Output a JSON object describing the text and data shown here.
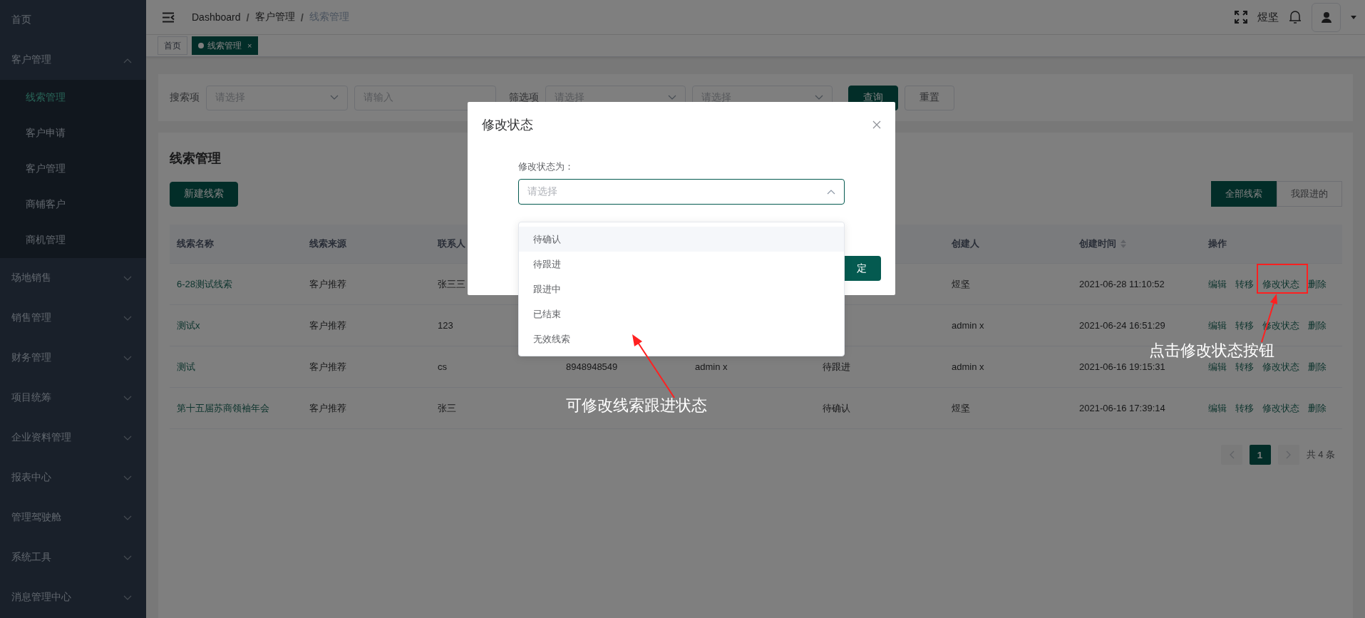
{
  "sidebar": {
    "items": [
      {
        "kind": "link",
        "label": "首页"
      },
      {
        "kind": "group",
        "label": "客户管理",
        "expanded": true,
        "children": [
          {
            "label": "线索管理",
            "selected": true
          },
          {
            "label": "客户申请",
            "selected": false
          },
          {
            "label": "客户管理",
            "selected": false
          },
          {
            "label": "商铺客户",
            "selected": false
          },
          {
            "label": "商机管理",
            "selected": false
          }
        ]
      },
      {
        "kind": "group",
        "label": "场地销售",
        "expanded": false
      },
      {
        "kind": "group",
        "label": "销售管理",
        "expanded": false
      },
      {
        "kind": "group",
        "label": "财务管理",
        "expanded": false
      },
      {
        "kind": "group",
        "label": "项目统筹",
        "expanded": false
      },
      {
        "kind": "group",
        "label": "企业资料管理",
        "expanded": false
      },
      {
        "kind": "group",
        "label": "报表中心",
        "expanded": false
      },
      {
        "kind": "group",
        "label": "管理驾驶舱",
        "expanded": false
      },
      {
        "kind": "group",
        "label": "系统工具",
        "expanded": false
      },
      {
        "kind": "group",
        "label": "消息管理中心",
        "expanded": false
      }
    ]
  },
  "header": {
    "breadcrumb": [
      "Dashboard",
      "客户管理",
      "线索管理"
    ],
    "breadcrumb_separator": "/",
    "user_name": "煜坚"
  },
  "tabs": [
    {
      "label": "首页",
      "selected": false
    },
    {
      "label": "线索管理",
      "selected": true,
      "close": "×"
    }
  ],
  "filters": {
    "search_label": "搜索项",
    "search_select": {
      "placeholder": "请选择"
    },
    "search_input": {
      "placeholder": "请输入"
    },
    "filter_label": "筛选项",
    "filter_selects": [
      {
        "placeholder": "请选择"
      },
      {
        "placeholder": "请选择"
      }
    ],
    "buttons": [
      {
        "label": "查询",
        "kind": "primary"
      },
      {
        "label": "重置",
        "kind": "default"
      }
    ]
  },
  "panel": {
    "title": "线索管理",
    "new_button": "新建线索",
    "view_toggle": [
      {
        "label": "全部线索",
        "selected": true
      },
      {
        "label": "我跟进的",
        "selected": false
      }
    ]
  },
  "table": {
    "columns": [
      {
        "label": "线索名称"
      },
      {
        "label": "线索来源"
      },
      {
        "label": "联系人"
      },
      {},
      {},
      {},
      {
        "label": "创建人"
      },
      {
        "label": "创建时间",
        "sortable": true
      },
      {
        "label": "操作"
      }
    ],
    "rows": [
      {
        "cells": [
          "6-28测试线索",
          "客户推荐",
          "张三三",
          null,
          null,
          null,
          "煜坚",
          "2021-06-28 11:10:52"
        ],
        "actions": [
          "编辑",
          "转移",
          "修改状态",
          "删除"
        ]
      },
      {
        "cells": [
          "测试x",
          "客户推荐",
          "123",
          null,
          null,
          null,
          "admin x",
          "2021-06-24 16:51:29"
        ],
        "actions": [
          "编辑",
          "转移",
          "修改状态",
          "删除"
        ]
      },
      {
        "cells": [
          "测试",
          "客户推荐",
          "cs",
          "8948948549",
          "admin x",
          "待跟进",
          "admin x",
          "2021-06-16 19:15:31"
        ],
        "actions": [
          "编辑",
          "转移",
          "修改状态",
          "删除"
        ]
      },
      {
        "cells": [
          "第十五届苏商领袖年会",
          "客户推荐",
          "张三",
          null,
          null,
          "待确认",
          "煜坚",
          "2021-06-16 17:39:14"
        ],
        "actions": [
          "编辑",
          "转移",
          "修改状态",
          "删除"
        ]
      }
    ]
  },
  "pagination": {
    "prev": {
      "disabled": true
    },
    "pages": [
      {
        "label": "1",
        "selected": true
      }
    ],
    "next": {
      "disabled": true
    },
    "total": "共 4 条"
  },
  "dialog": {
    "title": "修改状态",
    "field_label": "修改状态为：",
    "select": {
      "placeholder": "请选择",
      "expanded": true
    },
    "options": [
      {
        "label": "待确认",
        "highlighted": true
      },
      {
        "label": "待跟进",
        "highlighted": false
      },
      {
        "label": "跟进中",
        "highlighted": false
      },
      {
        "label": "已结束",
        "highlighted": false
      },
      {
        "label": "无效线索",
        "highlighted": false
      }
    ],
    "confirm_button": "定"
  },
  "annotations": [
    {
      "kind": "callout",
      "text": "点击修改状态按钮"
    },
    {
      "kind": "callout",
      "text": "可修改线索跟进状态"
    }
  ]
}
